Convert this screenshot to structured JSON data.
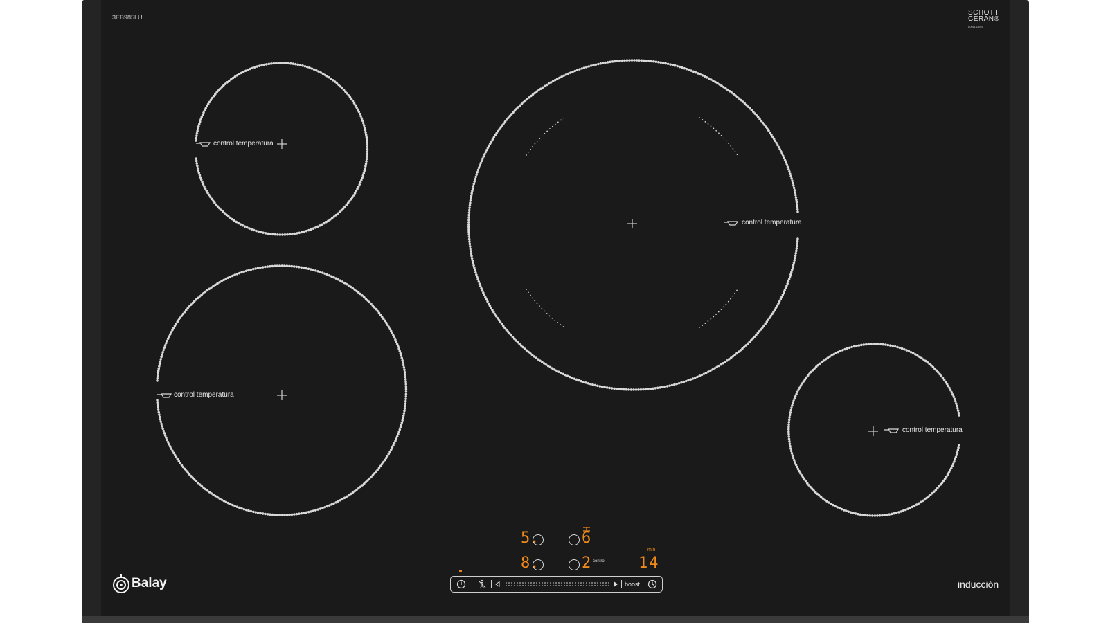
{
  "product": {
    "model_code": "3EB985LU",
    "brand": "Balay",
    "technology_label": "inducción",
    "glass_brand_line1": "SCHOTT",
    "glass_brand_line2": "CERAN®",
    "glass_serial": "8001143201"
  },
  "zones": [
    {
      "id": "rear-left",
      "label": "control temperatura"
    },
    {
      "id": "front-left",
      "label": "control temperatura"
    },
    {
      "id": "center-large",
      "label": "control temperatura"
    },
    {
      "id": "front-right",
      "label": "control temperatura"
    }
  ],
  "displays": {
    "rear_left_level": "5.",
    "front_left_level": "8.",
    "center_level": "6",
    "right_level": "2",
    "right_tag": "control",
    "timer_value": "14",
    "timer_unit": "min"
  },
  "control_panel": {
    "power_icon": "power-icon",
    "child_lock_icon": "child-lock-icon",
    "slider_left_icon": "triangle-left-icon",
    "slider_right_icon": "triangle-right-icon",
    "boost_label": "boost",
    "timer_icon": "clock-icon"
  },
  "colors": {
    "display_accent": "#f08a1a",
    "glass": "#1a1a1a",
    "frame": "#242424"
  }
}
